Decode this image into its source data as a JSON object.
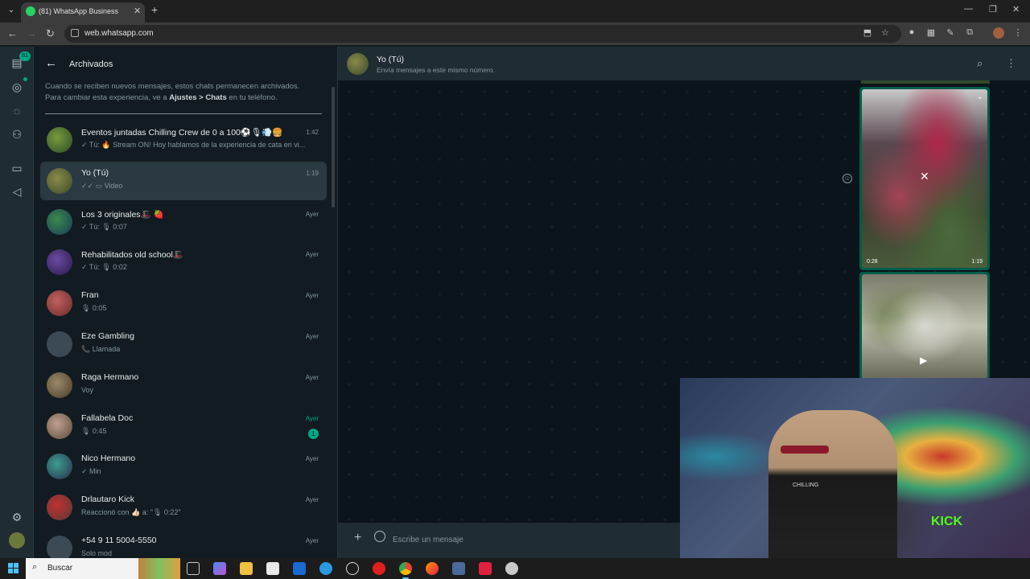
{
  "browser": {
    "tab_title": "(81) WhatsApp Business",
    "url": "web.whatsapp.com"
  },
  "rail": {
    "chats_badge": "81"
  },
  "sidebar": {
    "title": "Archivados",
    "info_prefix": "Cuando se reciben nuevos mensajes, estos chats permanecen archivados. Para cambiar esta experiencia, ve a ",
    "info_bold1": "Ajustes",
    "info_sep": " > ",
    "info_bold2": "Chats",
    "info_suffix": " en tu teléfono.",
    "chats": [
      {
        "name": "Eventos juntadas Chilling Crew de 0 a 100⚽🎙💨🍔",
        "preview": "✓ Tú: 🔥 Stream ON! Hoy hablamos de la experiencia de cata en vi...",
        "time": "1:42"
      },
      {
        "name": "Yo (Tú)",
        "preview": "✓✓ ▭ Video",
        "time": "1:19"
      },
      {
        "name": "Los 3 originales🎩 🍓",
        "preview": "✓ Tú: 🎙 0:07",
        "time": "Ayer"
      },
      {
        "name": "Rehabilitados old school🎩",
        "preview": "✓ Tú: 🎙 0:02",
        "time": "Ayer"
      },
      {
        "name": "Fran",
        "preview": "🎙 0:05",
        "time": "Ayer"
      },
      {
        "name": "Eze Gambling",
        "preview": "📞 Llamada",
        "time": "Ayer"
      },
      {
        "name": "Raga Hermano",
        "preview": "Voy",
        "time": "Ayer"
      },
      {
        "name": "Fallabela Doc",
        "preview": "🎙 0:45",
        "time": "Ayer",
        "unread": "1"
      },
      {
        "name": "Nico Hermano",
        "preview": "✓ Min",
        "time": "Ayer"
      },
      {
        "name": "Drlautaro Kick",
        "preview": "Reaccionó con 👍🏻 a: \"🎙 0:22\"",
        "time": "Ayer"
      },
      {
        "name": "+54 9 11 5004-5550",
        "preview": "Solo mod",
        "time": "Ayer"
      }
    ]
  },
  "chat": {
    "name": "Yo (Tú)",
    "subtitle": "Envía mensajes a este mismo número.",
    "media1_duration": "0:28",
    "media1_time": "1:19",
    "composer_placeholder": "Escribe un mensaje"
  },
  "webcam": {
    "kick_text": "KICK",
    "shirt_text": "CHILLING"
  },
  "taskbar": {
    "search_label": "Buscar"
  },
  "colors": {
    "accent": "#00a884",
    "panel": "#202c33",
    "background": "#111b21"
  }
}
